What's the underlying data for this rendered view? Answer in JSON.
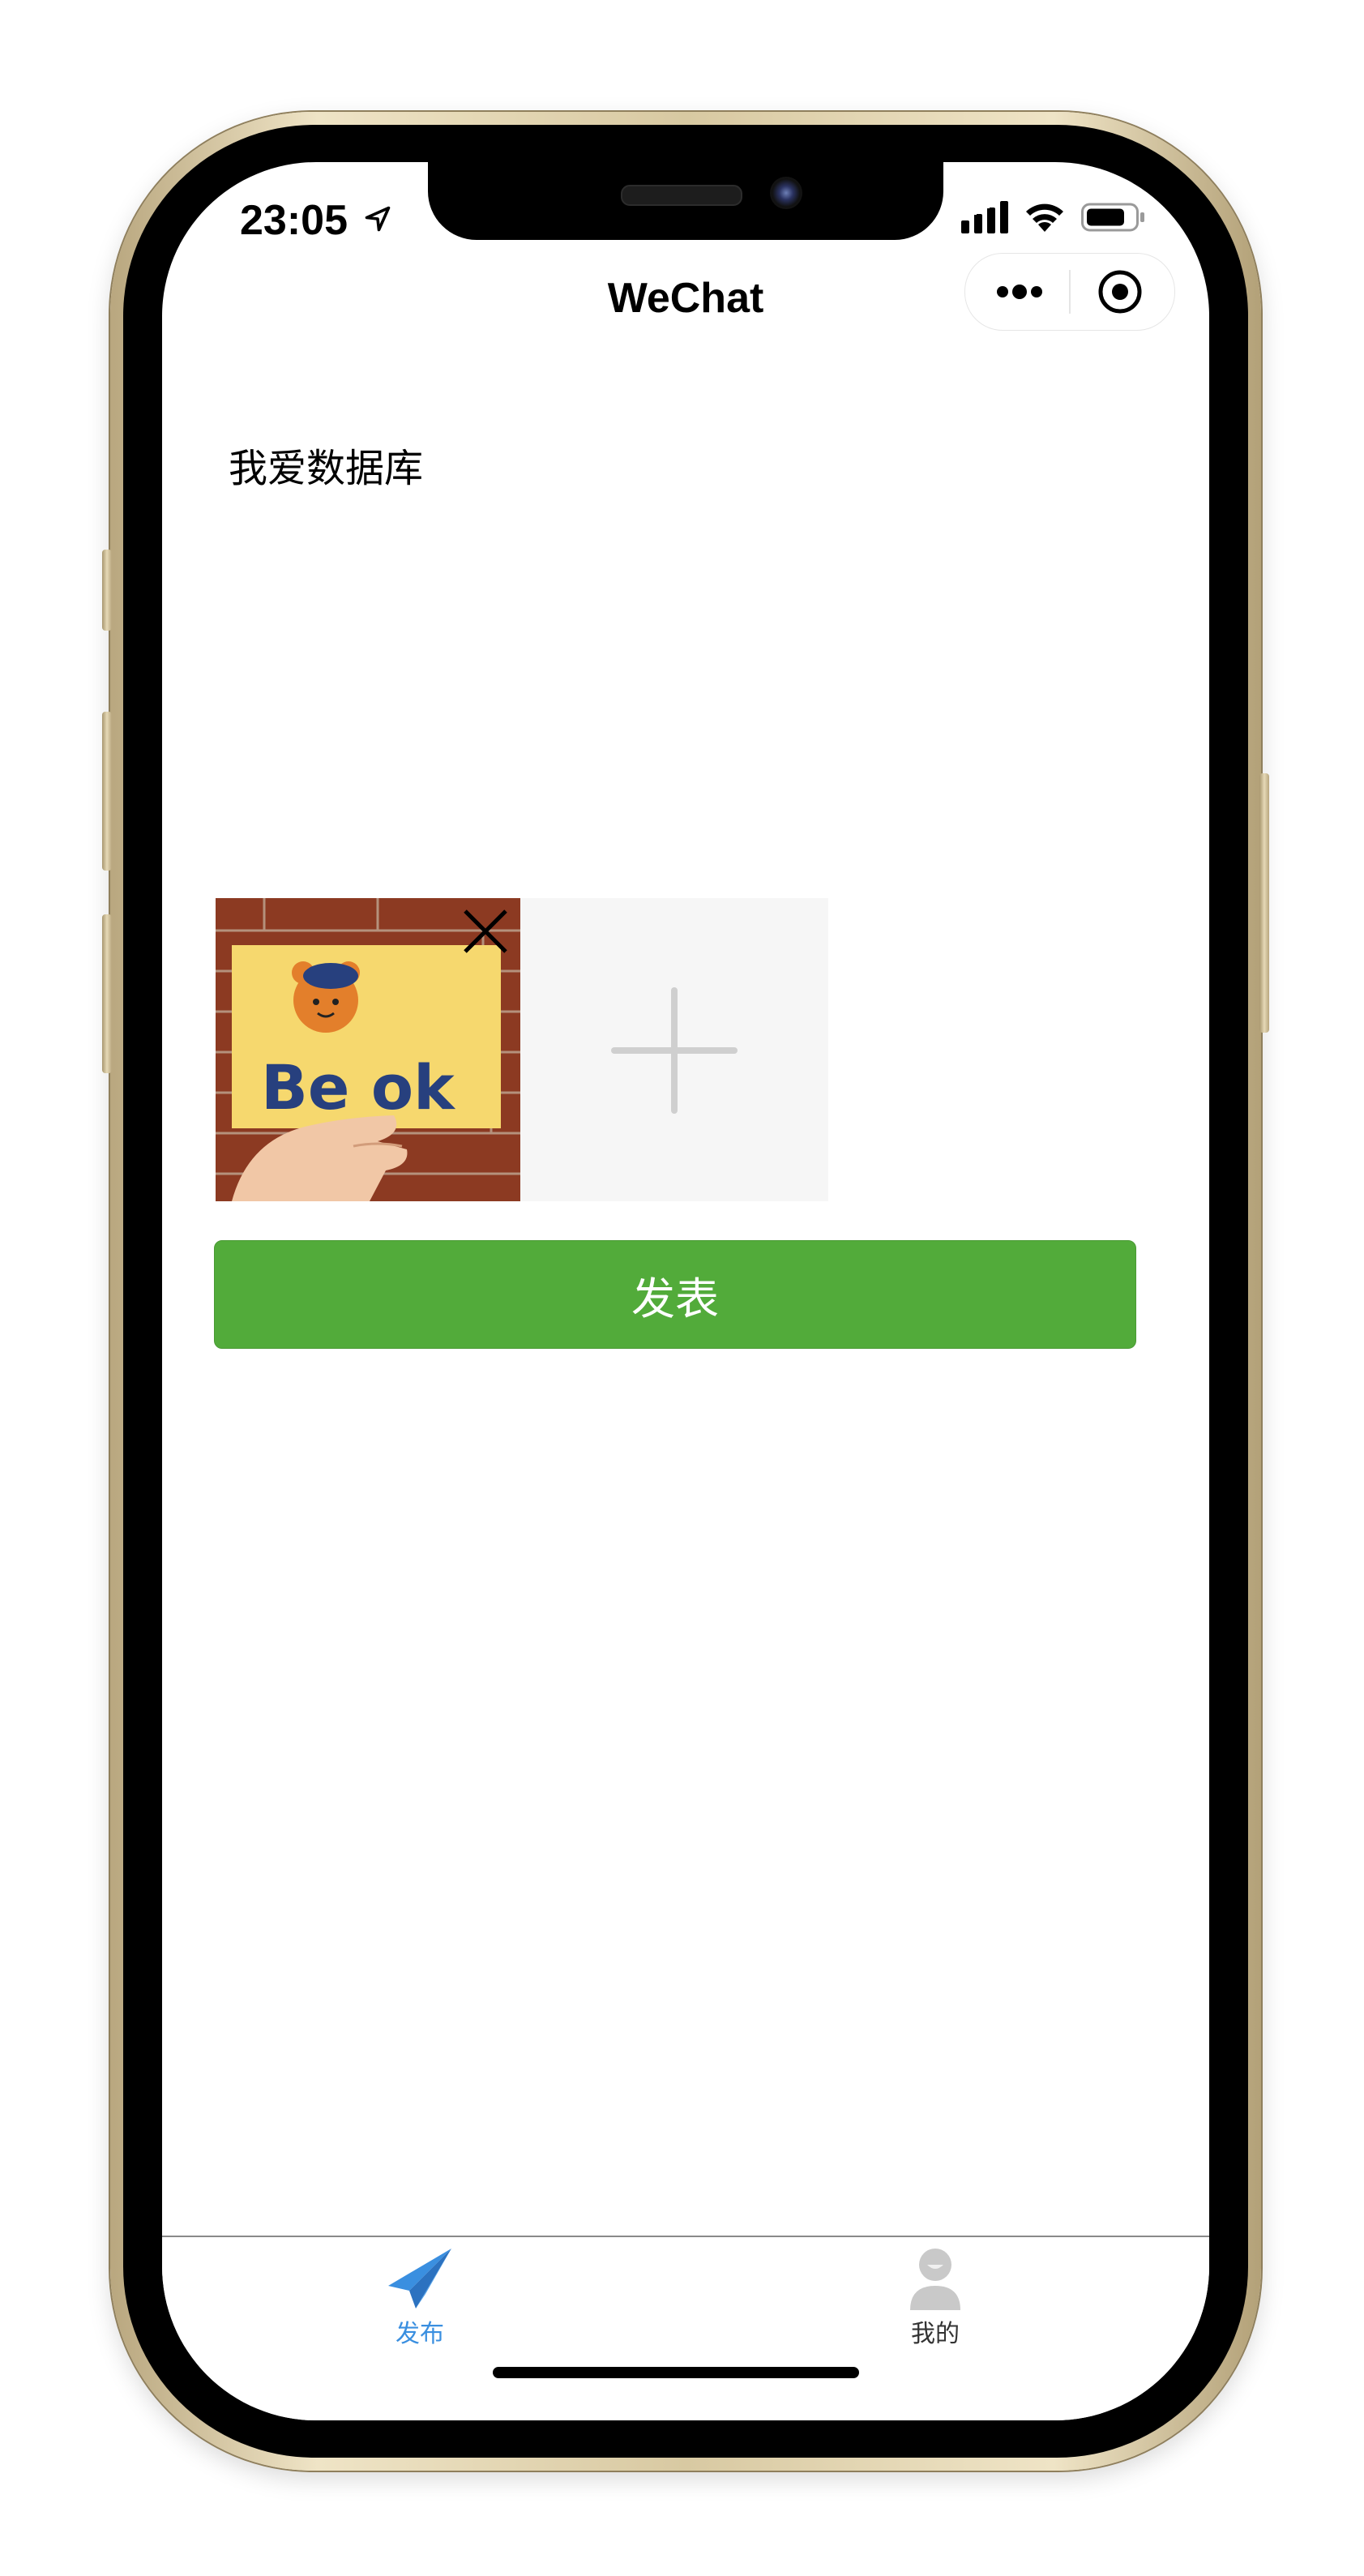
{
  "status_bar": {
    "time": "23:05",
    "icons": [
      "location-arrow-icon",
      "signal-icon",
      "wifi-icon",
      "battery-icon"
    ]
  },
  "nav_bar": {
    "title": "WeChat",
    "capsule_icons": [
      "more-icon",
      "close-mini-program-icon"
    ]
  },
  "post": {
    "text": "我爱数据库",
    "images": [
      {
        "caption": "Be ok"
      }
    ],
    "add_image_icon": "plus-icon",
    "remove_icon": "close-x-icon",
    "publish_label": "发表"
  },
  "tab_bar": {
    "tabs": [
      {
        "label": "发布",
        "icon": "paper-plane-icon",
        "active": true
      },
      {
        "label": "我的",
        "icon": "user-icon",
        "active": false
      }
    ],
    "active_color": "#3a8fe0",
    "inactive_color": "#333333"
  },
  "colors": {
    "publish_button": "#52ab3a",
    "add_tile_bg": "#f6f6f6"
  }
}
